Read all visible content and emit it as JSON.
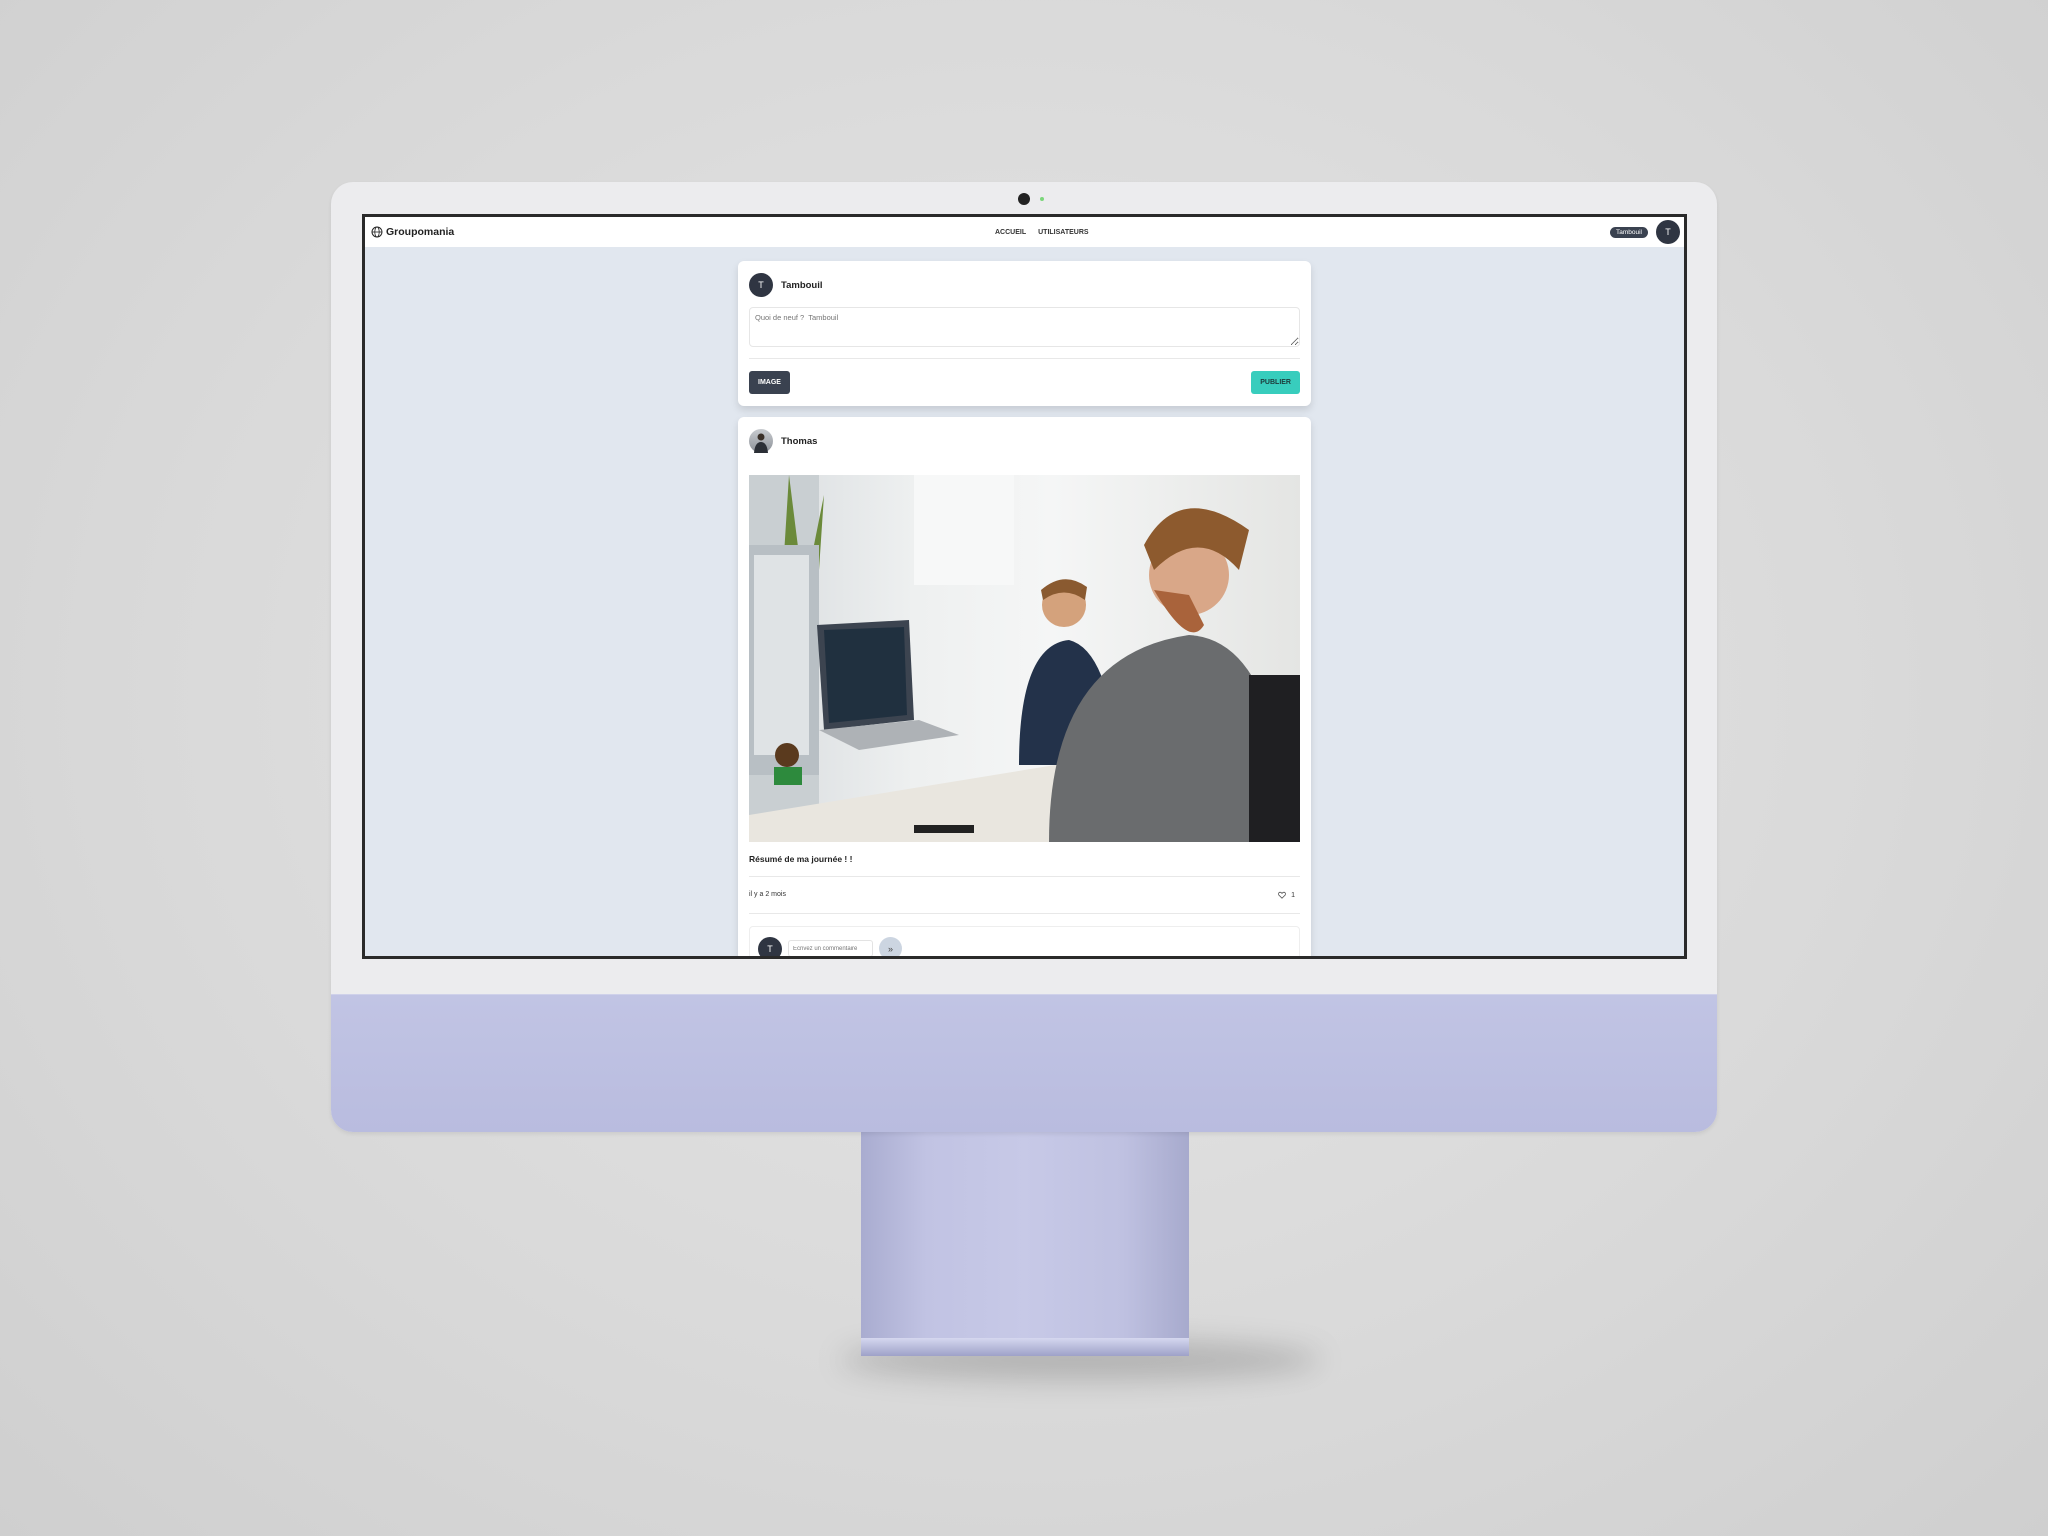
{
  "app": {
    "name": "Groupomania"
  },
  "nav": {
    "links": [
      "ACCUEIL",
      "UTILISATEURS"
    ],
    "user_pill": "Tambouil",
    "avatar_initial": "T"
  },
  "composer": {
    "user": "Tambouil",
    "avatar_initial": "T",
    "placeholder": "Quoi de neuf ?  Tambouil",
    "image_button": "IMAGE",
    "publish_button": "PUBLIER"
  },
  "post": {
    "author": "Thomas",
    "caption": "Résumé de ma journée ! !",
    "time": "il y a 2 mois",
    "likes": "1",
    "comment": {
      "avatar_initial": "T",
      "placeholder": "Ecrivez un commentaire",
      "send_icon": "»"
    }
  },
  "colors": {
    "accent": "#38cdbd",
    "dark": "#3a4250",
    "page_bg": "#e1e7ef",
    "device": "#bfc2e2"
  }
}
